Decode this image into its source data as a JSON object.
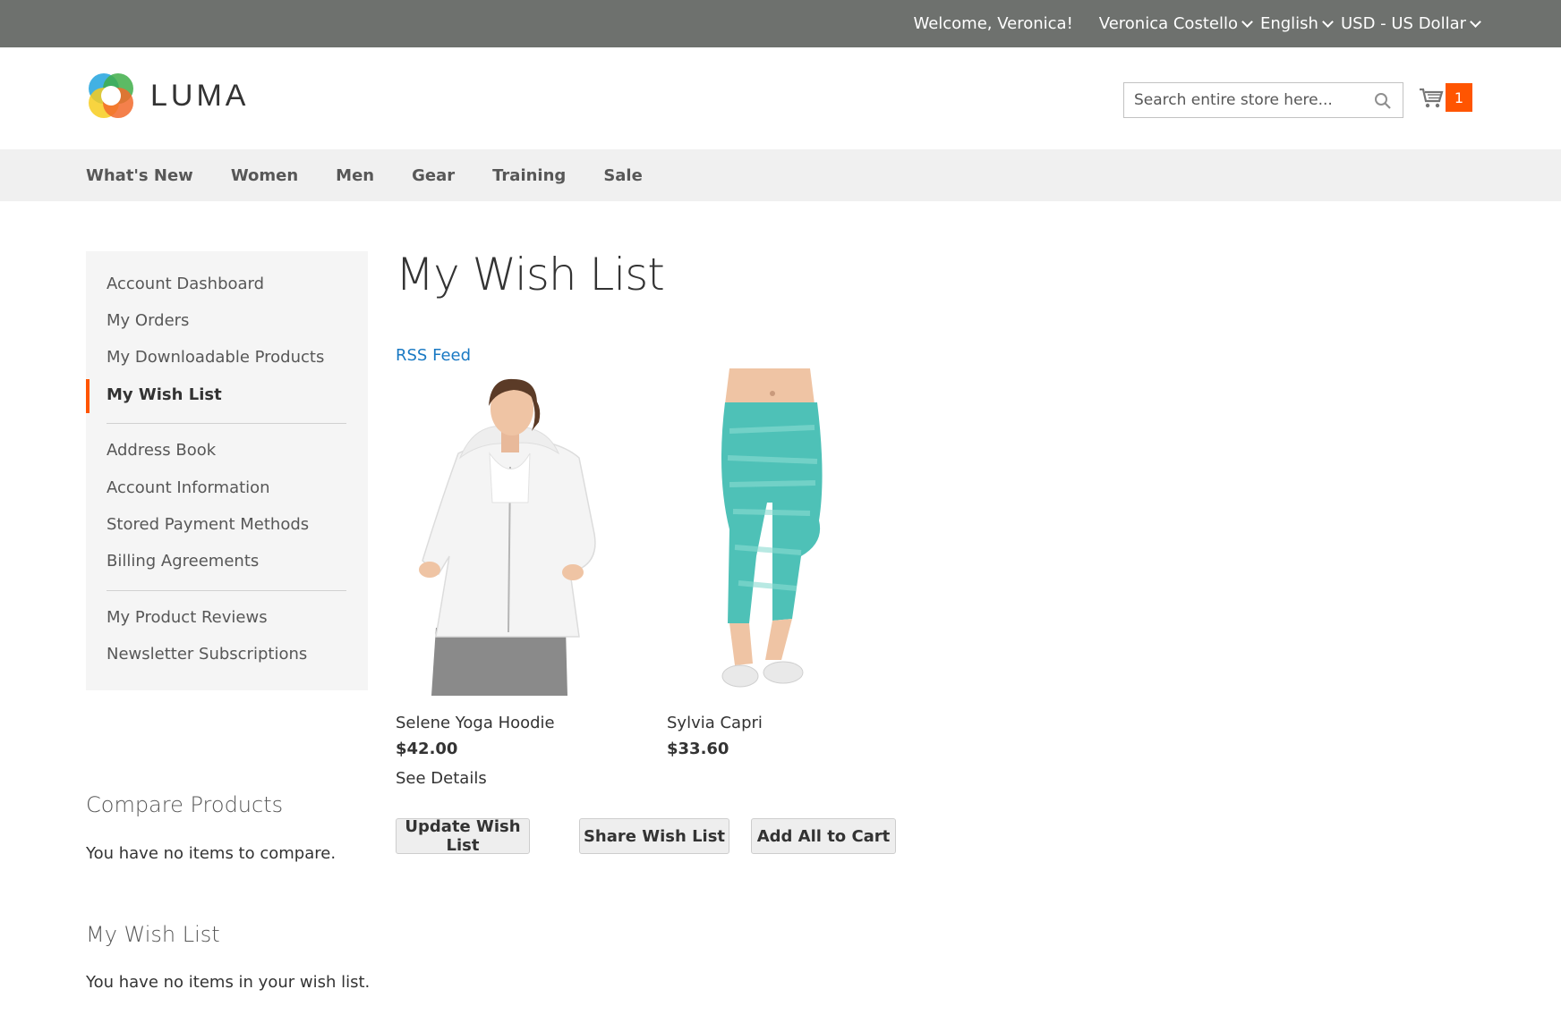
{
  "panel": {
    "welcome": "Welcome, Veronica!",
    "account_name": "Veronica Costello",
    "language": "English",
    "currency": "USD - US Dollar"
  },
  "header": {
    "logo_text": "LUMA",
    "search_placeholder": "Search entire store here...",
    "cart_count": "1"
  },
  "nav": {
    "items": [
      "What's New",
      "Women",
      "Men",
      "Gear",
      "Training",
      "Sale"
    ]
  },
  "account_nav": {
    "items": [
      "Account Dashboard",
      "My Orders",
      "My Downloadable Products",
      "My Wish List",
      "Address Book",
      "Account Information",
      "Stored Payment Methods",
      "Billing Agreements",
      "My Product Reviews",
      "Newsletter Subscriptions"
    ],
    "current": "My Wish List"
  },
  "sidebar": {
    "compare_title": "Compare Products",
    "compare_text": "You have no items to compare.",
    "wishlist_title": "My Wish List",
    "wishlist_text": "You have no items in your wish list."
  },
  "main": {
    "title": "My Wish List",
    "rss_label": "RSS Feed",
    "products": [
      {
        "name": "Selene Yoga Hoodie",
        "price": "$42.00",
        "details_label": "See Details"
      },
      {
        "name": "Sylvia Capri",
        "price": "$33.60"
      }
    ],
    "buttons": {
      "update": "Update Wish List",
      "share": "Share Wish List",
      "add_all": "Add All to Cart"
    }
  },
  "colors": {
    "panel_bg": "#6e716e",
    "accent": "#ff5501",
    "link": "#1979c3",
    "nav_bg": "#f0f0f0"
  }
}
